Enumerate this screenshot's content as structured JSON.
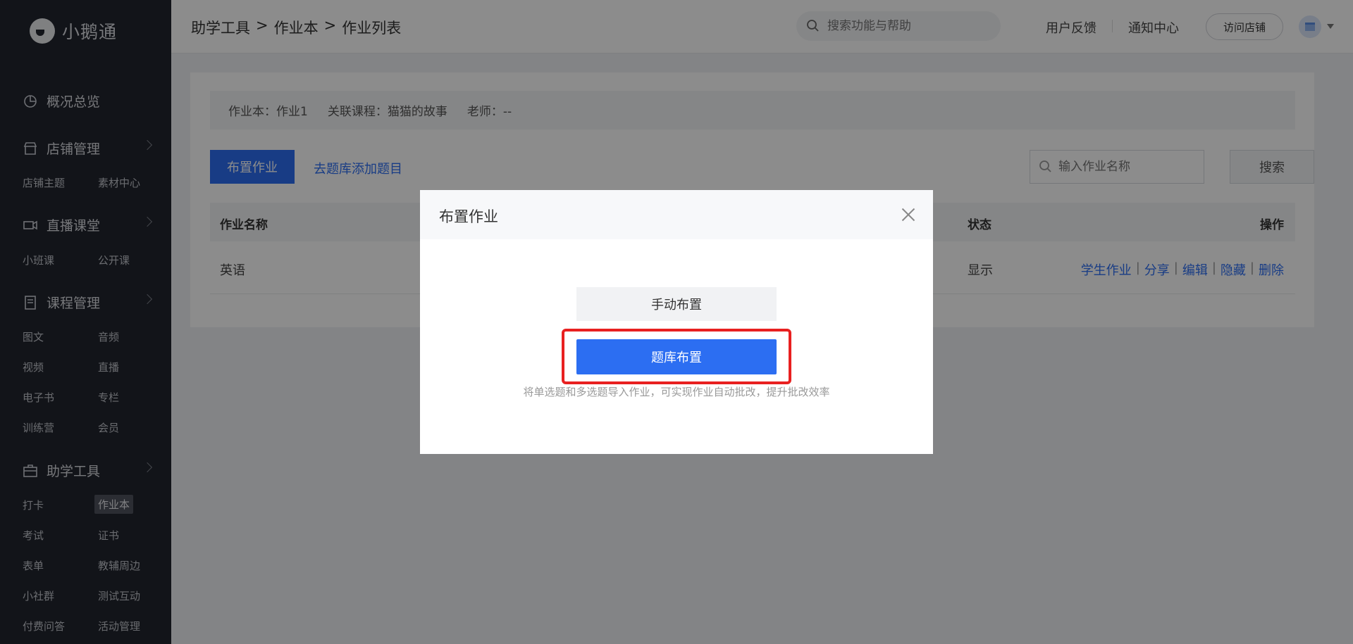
{
  "sidebar": {
    "logo_text": "小鹅通",
    "overview": "概况总览",
    "groups": [
      {
        "title": "店铺管理",
        "items": [
          "店铺主题",
          "素材中心"
        ]
      },
      {
        "title": "直播课堂",
        "items": [
          "小班课",
          "公开课"
        ]
      },
      {
        "title": "课程管理",
        "items": [
          "图文",
          "音频",
          "视频",
          "直播",
          "电子书",
          "专栏",
          "训练营",
          "会员"
        ]
      },
      {
        "title": "助学工具",
        "items": [
          "打卡",
          "作业本",
          "考试",
          "证书",
          "表单",
          "教辅周边",
          "小社群",
          "测试互动",
          "付费问答",
          "活动管理"
        ]
      }
    ],
    "active_item": "作业本"
  },
  "topbar": {
    "breadcrumb": [
      "助学工具",
      ">",
      "作业本",
      ">",
      "作业列表"
    ],
    "search_placeholder": "搜索功能与帮助",
    "feedback": "用户反馈",
    "notifications": "通知中心",
    "visit_store": "访问店铺"
  },
  "content": {
    "info": {
      "workbook": "作业本：作业1",
      "course": "关联课程：猫猫的故事",
      "teacher": "老师：--"
    },
    "assign_button": "布置作业",
    "add_question_link": "去题库添加题目",
    "search_placeholder": "输入作业名称",
    "search_button": "搜索",
    "table": {
      "headers": {
        "name": "作业名称",
        "status": "状态",
        "actions": "操作"
      },
      "rows": [
        {
          "name": "英语",
          "status": "显示",
          "actions": [
            "学生作业",
            "分享",
            "编辑",
            "隐藏",
            "删除"
          ]
        }
      ]
    }
  },
  "modal": {
    "title": "布置作业",
    "manual_button": "手动布置",
    "bank_button": "题库布置",
    "hint": "将单选题和多选题导入作业，可实现作业自动批改，提升批改效率"
  },
  "colors": {
    "primary": "#2c6ef2",
    "sidebar_bg": "#22252e",
    "highlight": "#e82020"
  }
}
